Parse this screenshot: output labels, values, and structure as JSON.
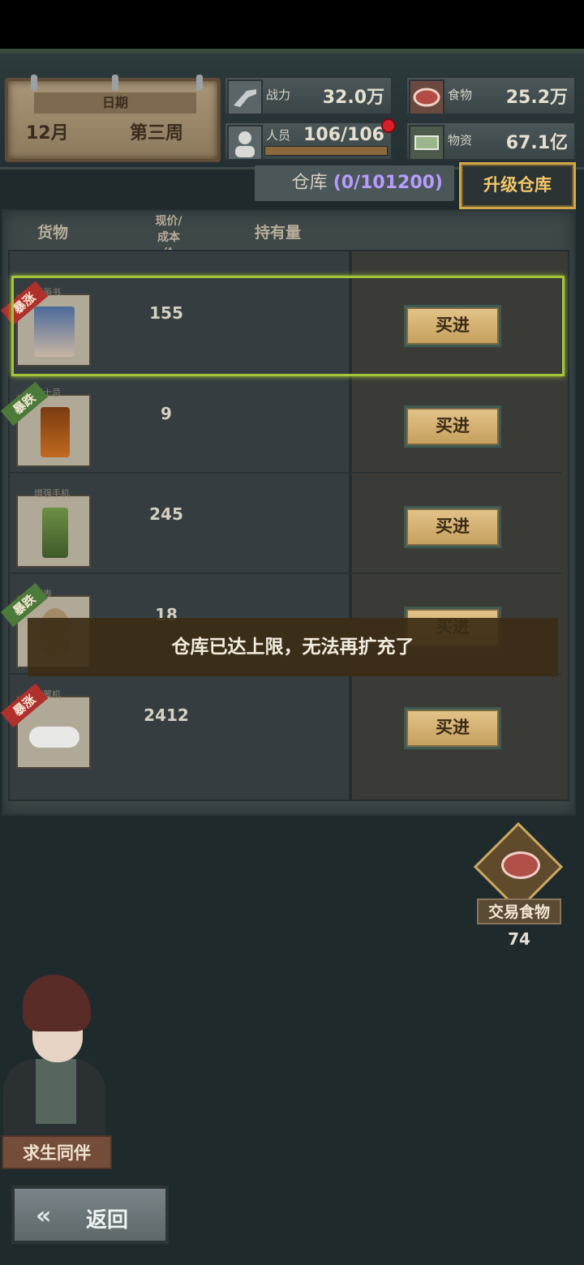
{
  "date": {
    "label": "日期",
    "month": "12月",
    "week": "第三周"
  },
  "stats": {
    "power": {
      "label": "战力",
      "value": "32.0万"
    },
    "food": {
      "label": "食物",
      "value": "25.2万"
    },
    "people": {
      "label": "人员",
      "value": "106/106",
      "fill": 1.0
    },
    "supplies": {
      "label": "物资",
      "value": "67.1亿"
    }
  },
  "warehouse": {
    "label": "仓库",
    "capacity": "(0/101200)",
    "upgrade_label": "升级仓库"
  },
  "table": {
    "headers": {
      "goods": "货物",
      "price_line1": "现价/",
      "price_line2": "成本价",
      "holding": "持有量"
    },
    "rows": [
      {
        "name": "漫画书",
        "price": "155",
        "tag": "暴涨",
        "buy_label": "买进"
      },
      {
        "name": "威士忌",
        "price": "9",
        "tag": "暴跌",
        "buy_label": "买进"
      },
      {
        "name": "增强手机",
        "price": "245",
        "tag": "",
        "buy_label": "买进"
      },
      {
        "name": "腕表",
        "price": "18",
        "tag": "暴跌",
        "buy_label": "买进"
      },
      {
        "name": "旋翼机",
        "price": "2412",
        "tag": "暴涨",
        "buy_label": "买进"
      }
    ]
  },
  "toast": "仓库已达上限，无法再扩充了",
  "trade_food": {
    "label": "交易食物",
    "count": "74"
  },
  "companion": {
    "label": "求生同伴"
  },
  "back": {
    "label": "返回"
  }
}
